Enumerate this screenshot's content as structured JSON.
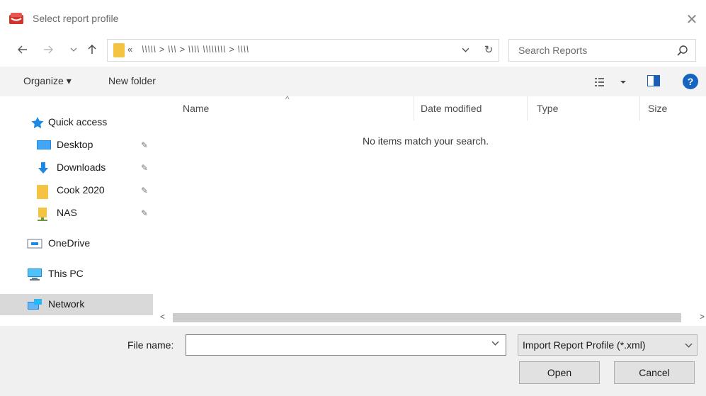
{
  "window": {
    "title": "Select report profile",
    "close_glyph": "✕"
  },
  "address": {
    "chevron": "«",
    "path": "\\\\\\\\\\ > \\\\\\ > \\\\\\\\ \\\\\\\\\\\\\\\\ > \\\\\\\\",
    "refresh_glyph": "↻"
  },
  "search": {
    "placeholder": "Search Reports"
  },
  "toolbar": {
    "organize_label": "Organize ▾",
    "new_folder_label": "New folder",
    "help_glyph": "?"
  },
  "nav": {
    "quick_access": "Quick access",
    "items": [
      {
        "label": "Desktop",
        "icon": "desktop-icon",
        "pinned": true
      },
      {
        "label": "Downloads",
        "icon": "downloads-icon",
        "pinned": true
      },
      {
        "label": "Cook 2020",
        "icon": "folder-icon",
        "pinned": true
      },
      {
        "label": "NAS",
        "icon": "nas-drive-icon",
        "pinned": true
      }
    ],
    "onedrive": "OneDrive",
    "this_pc": "This PC",
    "network": "Network",
    "pin_glyph": "✈"
  },
  "columns": {
    "name": "Name",
    "date_modified": "Date modified",
    "type": "Type",
    "size": "Size"
  },
  "empty_message": "No items match your search.",
  "file_name": {
    "label": "File name:",
    "value": ""
  },
  "file_type": {
    "selected": "Import Report Profile (*.xml)"
  },
  "buttons": {
    "open": "Open",
    "cancel": "Cancel"
  },
  "colors": {
    "accent": "#1565c0",
    "folder": "#f5c342",
    "selected_nav": "#d9d9d9"
  }
}
